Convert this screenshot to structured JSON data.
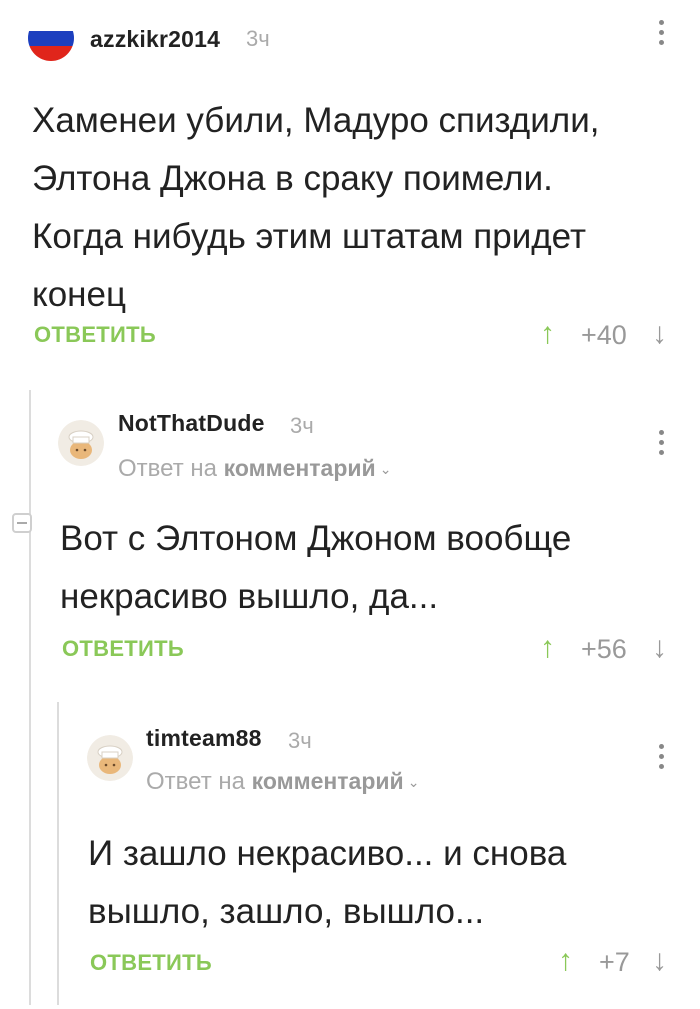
{
  "comments": [
    {
      "username": "azzkikr2014",
      "time": "3ч",
      "text_lines": [
        "Хаменеи убили, Мадуро спиздили,",
        "Элтона Джона в сраку поимели.",
        "Когда нибудь этим штатам придет",
        "конец"
      ],
      "reply_label": "ОТВЕТИТЬ",
      "rating": "+40",
      "avatar": "russia-flag"
    },
    {
      "username": "NotThatDude",
      "time": "3ч",
      "reply_prefix": "Ответ на",
      "reply_link": "комментарий",
      "text_lines": [
        "Вот с Элтоном Джоном вообще",
        "некрасиво вышло, да..."
      ],
      "reply_label": "ОТВЕТИТЬ",
      "rating": "+56",
      "avatar": "default-chef-avatar"
    },
    {
      "username": "timteam88",
      "time": "3ч",
      "reply_prefix": "Ответ на",
      "reply_link": "комментарий",
      "text_lines": [
        "И зашло некрасиво... и снова",
        "вышло, зашло, вышло..."
      ],
      "reply_label": "ОТВЕТИТЬ",
      "rating": "+7",
      "avatar": "default-chef-avatar"
    }
  ],
  "icons": {
    "upvote": "↑",
    "downvote": "↓",
    "more": "more-vertical-icon",
    "chevron": "chevron-down-icon"
  },
  "colors": {
    "accent_green": "#8ac858",
    "muted_gray": "#999999"
  }
}
